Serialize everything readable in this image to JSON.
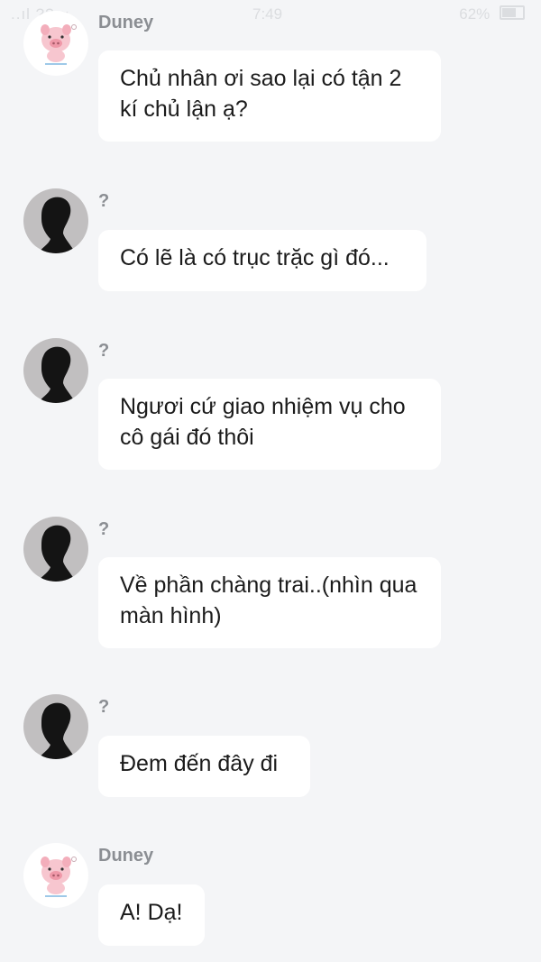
{
  "status_bar": {
    "carrier": "..ıl ?? ≈",
    "time": "7:49",
    "battery": "62%"
  },
  "messages": [
    {
      "sender": "Duney",
      "avatar": "pig-avatar",
      "text": "Chủ nhân ơi sao lại có tận 2 kí chủ lận ạ?"
    },
    {
      "sender": "?",
      "avatar": "silhouette-avatar",
      "text": "Có lẽ là có trục trặc gì đó..."
    },
    {
      "sender": "?",
      "avatar": "silhouette-avatar",
      "text": "Ngươi cứ giao nhiệm vụ cho cô gái đó thôi"
    },
    {
      "sender": "?",
      "avatar": "silhouette-avatar",
      "text": "Về phần chàng trai..(nhìn qua màn hình)"
    },
    {
      "sender": "?",
      "avatar": "silhouette-avatar",
      "text": "Đem đến đây đi"
    },
    {
      "sender": "Duney",
      "avatar": "pig-avatar",
      "text": "A! Dạ!"
    }
  ]
}
